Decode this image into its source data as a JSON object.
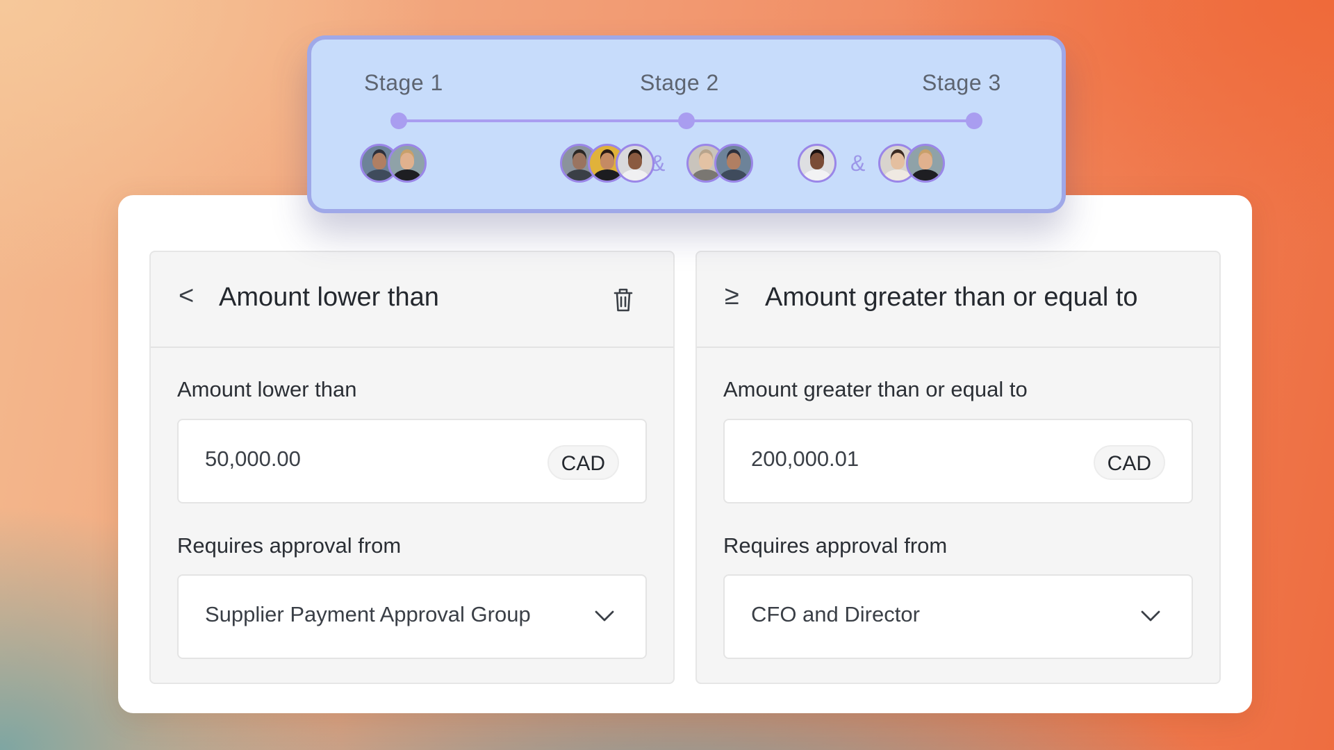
{
  "stages": [
    {
      "label": "Stage 1",
      "groups": [
        {
          "avatars": [
            {
              "name": "avatar-man-cap",
              "skin": "#b07f63",
              "hair": "#2c2f3b",
              "bg": "#6d8399",
              "shirt": "#3f4b5c"
            },
            {
              "name": "avatar-woman-blonde",
              "skin": "#e0b18e",
              "hair": "#c8a06a",
              "bg": "#8fa2a8",
              "shirt": "#1e1e22"
            }
          ]
        }
      ]
    },
    {
      "label": "Stage 2",
      "groups": [
        {
          "avatars": [
            {
              "name": "avatar-man-beard",
              "skin": "#9a7460",
              "hair": "#2a2624",
              "bg": "#8b939c",
              "shirt": "#3a3f46"
            },
            {
              "name": "avatar-woman-dark-hair",
              "skin": "#c58a63",
              "hair": "#2a1a16",
              "bg": "#e0b23a",
              "shirt": "#1c1c20"
            },
            {
              "name": "avatar-man-smiling",
              "skin": "#8a5a40",
              "hair": "#1e1612",
              "bg": "#d9d9dc",
              "shirt": "#f0f0f2"
            }
          ]
        },
        {
          "avatars": [
            {
              "name": "avatar-man-light",
              "skin": "#e3c2a4",
              "hair": "#b8a48c",
              "bg": "#c9c4bc",
              "shirt": "#7a7772"
            },
            {
              "name": "avatar-man-cap-2",
              "skin": "#b07f63",
              "hair": "#2c2f3b",
              "bg": "#6d8399",
              "shirt": "#3f4b5c"
            }
          ]
        }
      ]
    },
    {
      "label": "Stage 3",
      "groups": [
        {
          "avatars": [
            {
              "name": "avatar-man-portrait",
              "skin": "#7a4c36",
              "hair": "#1b1210",
              "bg": "#dedfe2",
              "shirt": "#f2f2f4"
            }
          ]
        },
        {
          "avatars": [
            {
              "name": "avatar-woman-long-hair",
              "skin": "#e4bfa0",
              "hair": "#3a2a22",
              "bg": "#d8d4ce",
              "shirt": "#efe9e2"
            },
            {
              "name": "avatar-woman-blonde-2",
              "skin": "#e0b18e",
              "hair": "#c8a06a",
              "bg": "#8fa2a8",
              "shirt": "#1e1e22"
            }
          ]
        }
      ]
    }
  ],
  "separator": "&",
  "rules": [
    {
      "operator": "<",
      "title": "Amount lower than",
      "amount_label": "Amount lower than",
      "amount_value": "50,000.00",
      "currency": "CAD",
      "approval_label": "Requires approval from",
      "approver": "Supplier Payment Approval Group",
      "deletable": true
    },
    {
      "operator": "≥",
      "title": "Amount greater than or equal to",
      "amount_label": "Amount greater than or equal to",
      "amount_value": "200,000.01",
      "currency": "CAD",
      "approval_label": "Requires approval from",
      "approver": "CFO and Director",
      "deletable": false
    }
  ],
  "icons": {
    "delete": "trash-icon",
    "dropdown": "chevron-down-icon"
  },
  "colors": {
    "timeline": "#a99df0",
    "panel": "#c7dcfb",
    "panel_border": "#9fa8e8"
  }
}
